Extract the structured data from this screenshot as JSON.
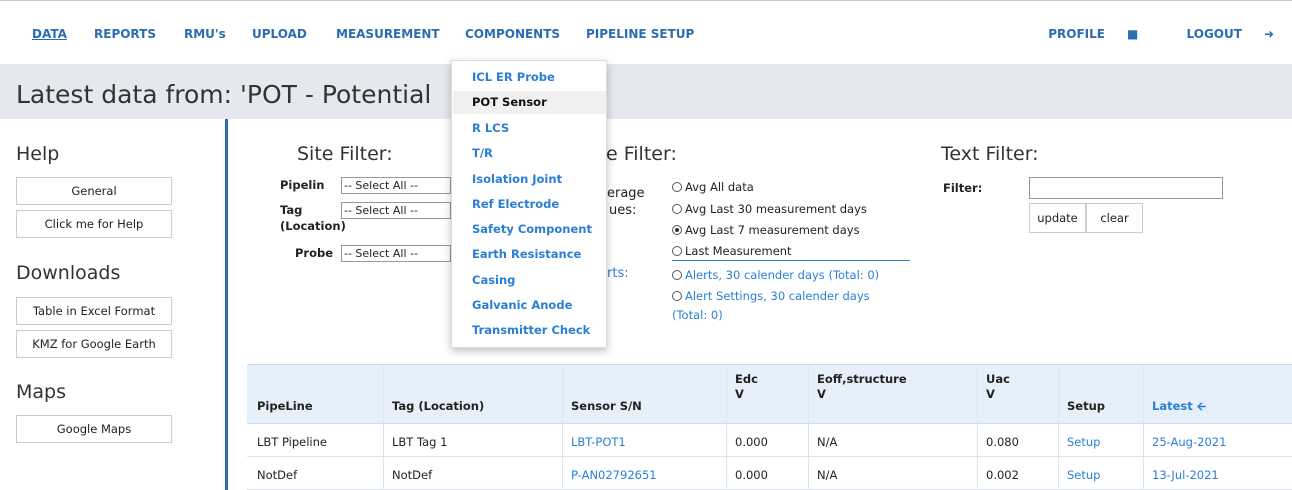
{
  "nav": {
    "items": [
      "DATA",
      "REPORTS",
      "RMU's",
      "UPLOAD",
      "MEASUREMENT",
      "COMPONENTS",
      "PIPELINE SETUP"
    ],
    "profile": "PROFILE",
    "logout": "LOGOUT"
  },
  "page_title": "Latest data from: 'POT - Potential",
  "sidebar": {
    "help_heading": "Help",
    "help_buttons": [
      "General",
      "Click me for Help"
    ],
    "downloads_heading": "Downloads",
    "download_buttons": [
      "Table in Excel Format",
      "KMZ for Google Earth"
    ],
    "maps_heading": "Maps",
    "map_buttons": [
      "Google Maps"
    ]
  },
  "site_filter": {
    "heading": "Site Filter:",
    "pipeline_label": "Pipelin",
    "tag_label": "Tag",
    "tag_label2": "(Location)",
    "probe_label": "Probe",
    "select_all": "-- Select All --"
  },
  "value_filter": {
    "heading": "e Filter:",
    "average_label": "erage",
    "values_label": "ues:",
    "alerts_label": "rts:",
    "options": [
      "Avg All data",
      "Avg Last 30 measurement days",
      "Avg Last 7 measurement days",
      "Last Measurement"
    ],
    "selected_index": 2,
    "alert_options": [
      "Alerts, 30 calender days (Total: 0)",
      "Alert Settings, 30 calender days",
      "(Total: 0)"
    ]
  },
  "text_filter": {
    "heading": "Text Filter:",
    "filter_label": "Filter:",
    "filter_value": "",
    "update_button": "update",
    "clear_button": "clear"
  },
  "components_menu": {
    "items": [
      "ICL ER Probe",
      "POT Sensor",
      "R LCS",
      "T/R",
      "Isolation Joint",
      "Ref Electrode",
      "Safety Component",
      "Earth Resistance",
      "Casing",
      "Galvanic Anode",
      "Transmitter Check"
    ],
    "active_index": 1
  },
  "table": {
    "headers": {
      "pipeline": "PipeLine",
      "tag": "Tag (Location)",
      "sensor": "Sensor S/N",
      "edc": "Edc",
      "edc_unit": "V",
      "eoff": "Eoff,structure",
      "eoff_unit": "V",
      "uac": "Uac",
      "uac_unit": "V",
      "setup": "Setup",
      "latest": "Latest"
    },
    "rows": [
      {
        "pipeline": "LBT Pipeline",
        "tag": "LBT Tag 1",
        "sensor": "LBT-POT1",
        "edc": "0.000",
        "eoff": "N/A",
        "uac": "0.080",
        "setup": "Setup",
        "latest": "25-Aug-2021"
      },
      {
        "pipeline": "NotDef",
        "tag": "NotDef",
        "sensor": "P-AN02792651",
        "edc": "0.000",
        "eoff": "N/A",
        "uac": "0.002",
        "setup": "Setup",
        "latest": "13-Jul-2021"
      }
    ]
  },
  "colors": {
    "accent": "#2a6db0",
    "link": "#2a7fd4",
    "title_band": "#e5e9ef",
    "table_header": "#e6f0fa"
  }
}
